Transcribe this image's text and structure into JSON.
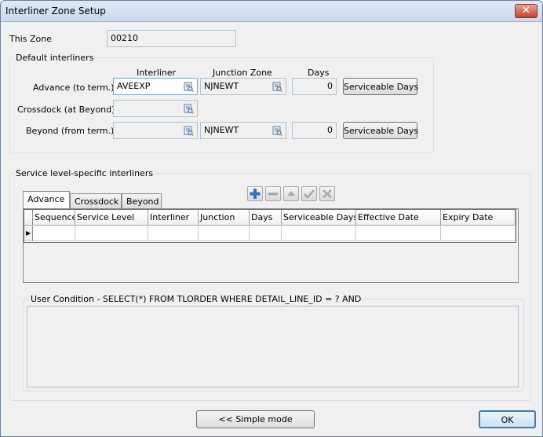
{
  "window": {
    "title": "Interliner Zone Setup",
    "close_glyph": "✕"
  },
  "this_zone": {
    "label": "This Zone",
    "value": "00210"
  },
  "default_interliners": {
    "group_label": "Default interliners",
    "col_interliner": "Interliner",
    "col_junction_zone": "Junction Zone",
    "col_days": "Days",
    "rows": [
      {
        "label": "Advance (to term.)",
        "interliner": "AVEEXP",
        "junction_zone": "NJNEWT",
        "days": "0",
        "button": "Serviceable Days"
      },
      {
        "label": "Crossdock (at Beyond)",
        "interliner": ""
      },
      {
        "label": "Beyond (from term.)",
        "interliner": "",
        "junction_zone": "NJNEWT",
        "days": "0",
        "button": "Serviceable Days"
      }
    ]
  },
  "service_level": {
    "group_label": "Service level-specific interliners",
    "tabs": [
      "Advance",
      "Crossdock",
      "Beyond"
    ],
    "toolbar_icons": [
      "add-icon",
      "remove-icon",
      "move-up-icon",
      "confirm-icon",
      "cancel-icon"
    ],
    "columns": [
      "Sequence",
      "Service Level",
      "Interliner",
      "Junction",
      "Days",
      "Serviceable Days",
      "Effective Date",
      "Expiry Date"
    ],
    "row_indicator": "▶",
    "user_condition_label": "User Condition - SELECT(*) FROM TLORDER WHERE DETAIL_LINE_ID = ? AND",
    "user_condition_value": ""
  },
  "footer": {
    "simple_mode": "<< Simple mode",
    "ok": "OK"
  },
  "colors": {
    "accent": "#3c7fb1",
    "titlebar": "#c9d9ee",
    "close": "#c7432d"
  }
}
